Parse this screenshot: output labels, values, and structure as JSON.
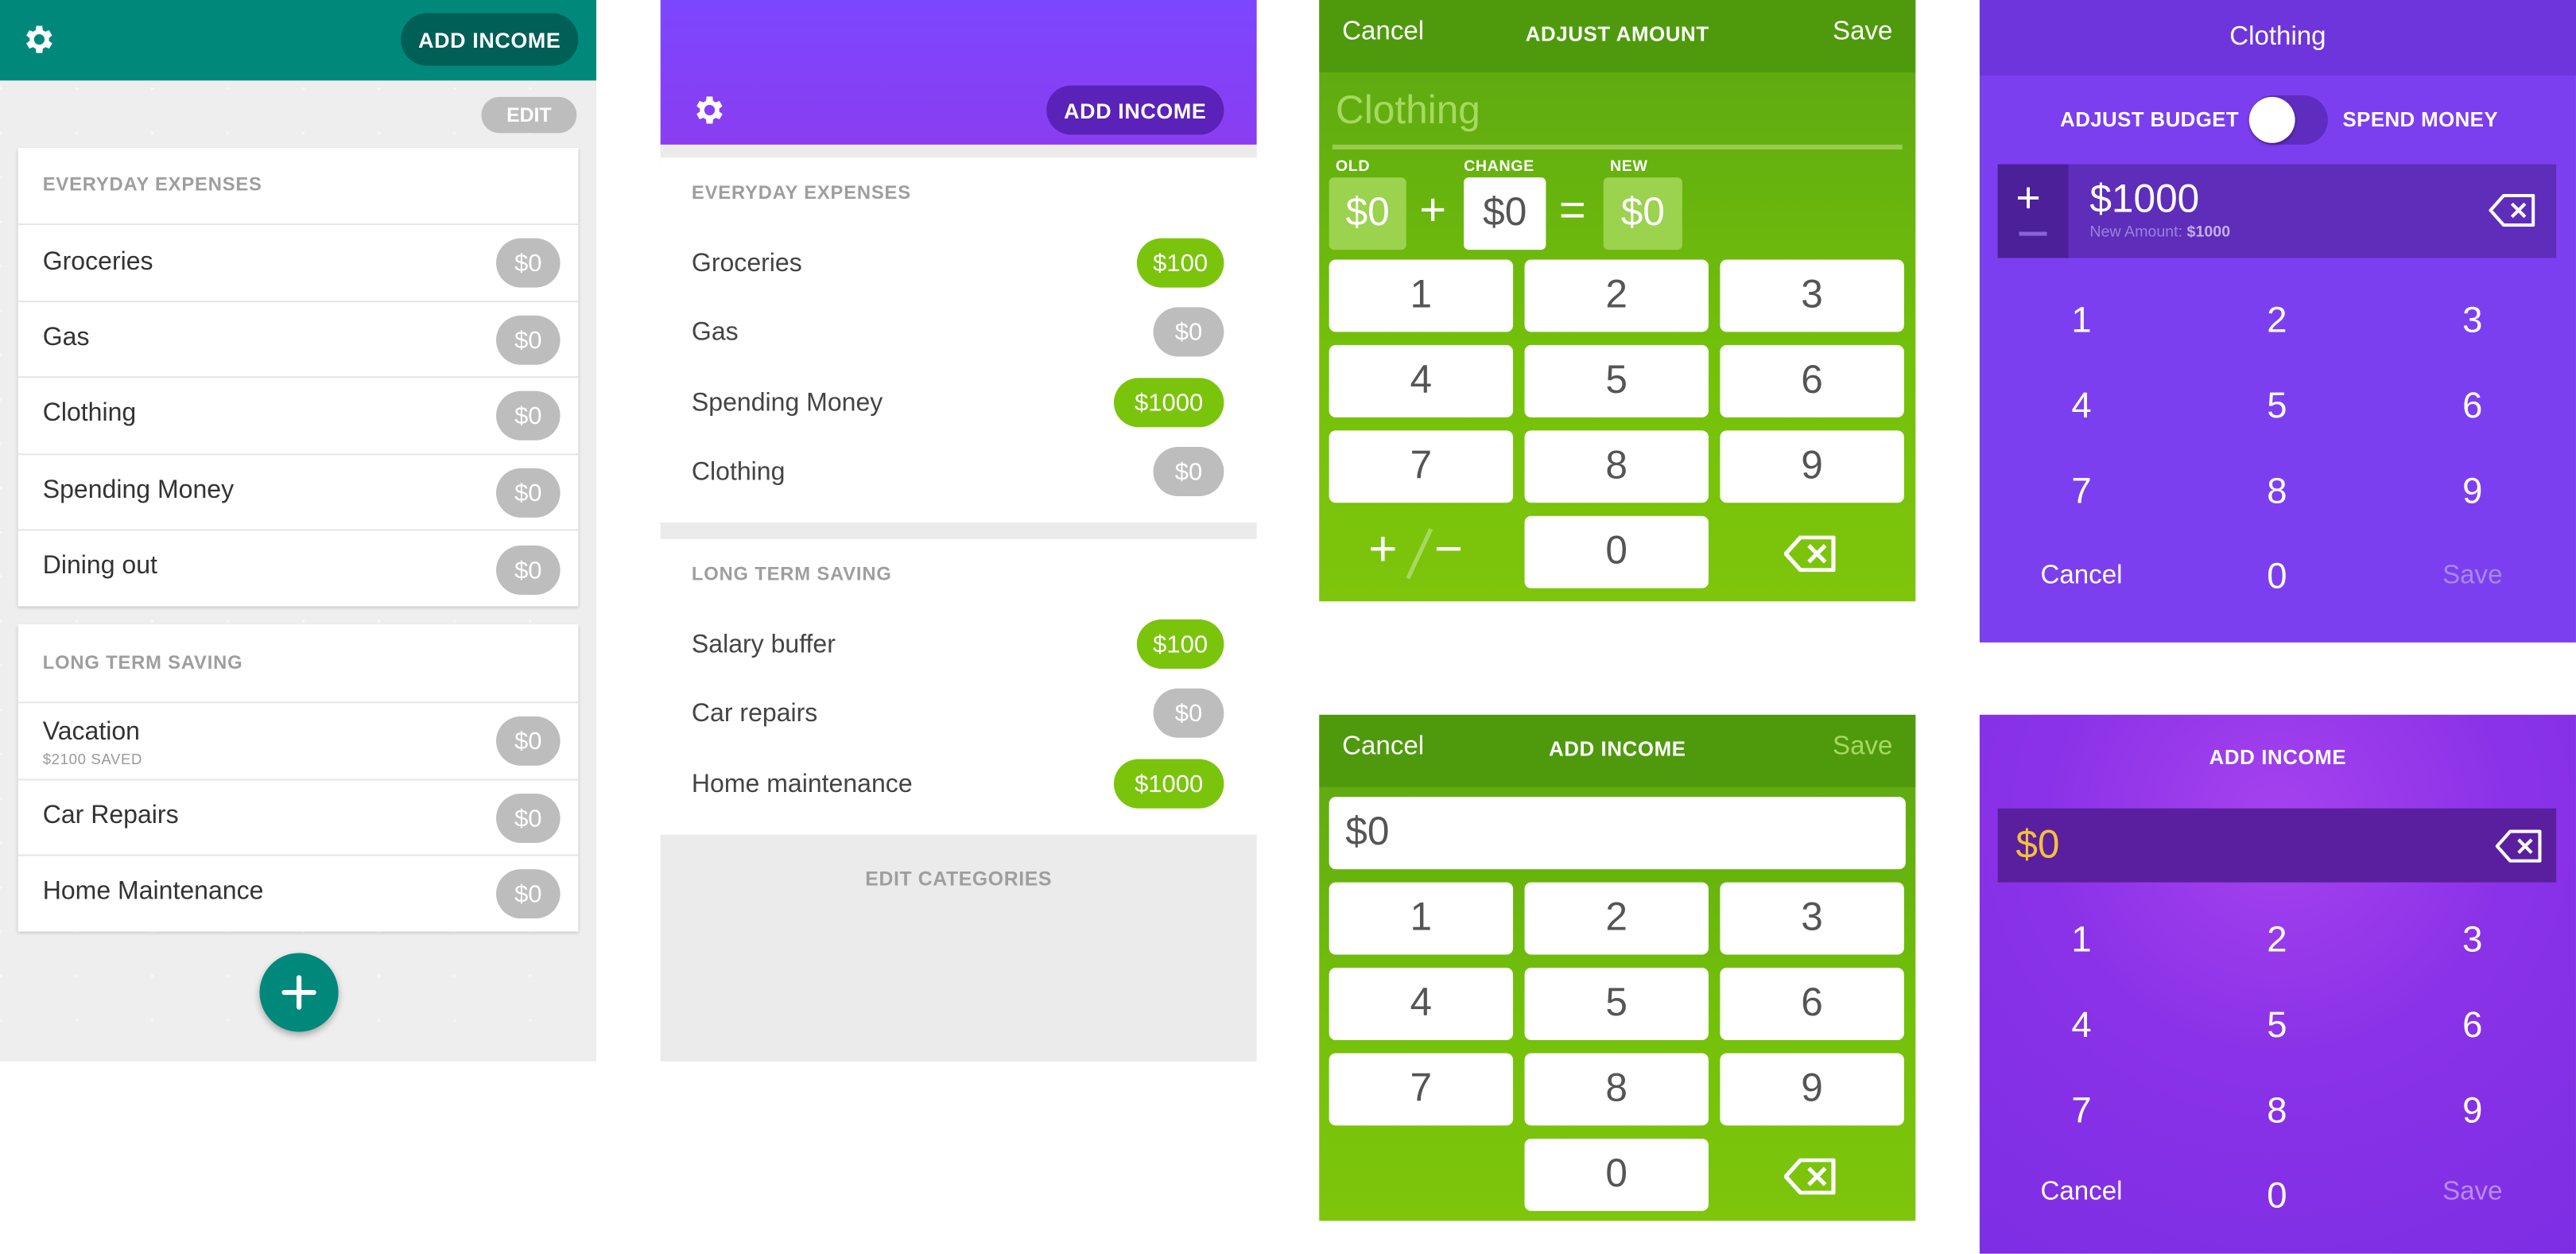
{
  "colors": {
    "teal": "#00897b",
    "teal_dark": "#005f56",
    "purple": "#7c46ff",
    "purple_dark": "#5a22b8",
    "green": "#74c10a",
    "green_dark": "#4e9a0c",
    "badge_gray": "#bdbdbd",
    "badge_green": "#7bc40c",
    "gold": "#f3c13a"
  },
  "teal_list": {
    "add_income": "ADD INCOME",
    "edit": "EDIT",
    "sections": [
      {
        "title": "EVERYDAY EXPENSES",
        "rows": [
          {
            "label": "Groceries",
            "amount": "$0"
          },
          {
            "label": "Gas",
            "amount": "$0"
          },
          {
            "label": "Clothing",
            "amount": "$0"
          },
          {
            "label": "Spending Money",
            "amount": "$0"
          },
          {
            "label": "Dining out",
            "amount": "$0"
          }
        ]
      },
      {
        "title": "LONG TERM SAVING",
        "rows": [
          {
            "label": "Vacation",
            "sub": "$2100 SAVED",
            "amount": "$0"
          },
          {
            "label": "Car Repairs",
            "amount": "$0"
          },
          {
            "label": "Home Maintenance",
            "amount": "$0"
          }
        ]
      }
    ],
    "fab_icon": "plus-icon",
    "settings_icon": "gear-icon"
  },
  "purple_list": {
    "add_income": "ADD INCOME",
    "settings_icon": "gear-icon",
    "sections": [
      {
        "title": "EVERYDAY EXPENSES",
        "rows": [
          {
            "label": "Groceries",
            "amount": "$100",
            "highlight": true
          },
          {
            "label": "Gas",
            "amount": "$0",
            "highlight": false
          },
          {
            "label": "Spending Money",
            "amount": "$1000",
            "highlight": true
          },
          {
            "label": "Clothing",
            "amount": "$0",
            "highlight": false
          }
        ]
      },
      {
        "title": "LONG TERM SAVING",
        "rows": [
          {
            "label": "Salary buffer",
            "amount": "$100",
            "highlight": true
          },
          {
            "label": "Car repairs",
            "amount": "$0",
            "highlight": false
          },
          {
            "label": "Home maintenance",
            "amount": "$1000",
            "highlight": true
          }
        ]
      }
    ],
    "edit_categories": "EDIT CATEGORIES"
  },
  "adjust_amount": {
    "cancel": "Cancel",
    "title": "ADJUST AMOUNT",
    "save": "Save",
    "category": "Clothing",
    "old_label": "OLD",
    "old_value": "$0",
    "plus": "+",
    "change_label": "CHANGE",
    "change_value": "$0",
    "equals": "=",
    "new_label": "NEW",
    "new_value": "$0",
    "keys": [
      "1",
      "2",
      "3",
      "4",
      "5",
      "6",
      "7",
      "8",
      "9",
      "0"
    ],
    "sign_toggle": "+/−",
    "sign_plus": "+",
    "sign_minus": "−"
  },
  "green_add_income": {
    "cancel": "Cancel",
    "title": "ADD INCOME",
    "save": "Save",
    "value": "$0",
    "keys": [
      "1",
      "2",
      "3",
      "4",
      "5",
      "6",
      "7",
      "8",
      "9",
      "0"
    ]
  },
  "purple_adjust": {
    "title": "Clothing",
    "adjust_budget": "ADJUST BUDGET",
    "spend_money": "SPEND MONEY",
    "toggle_on": false,
    "plus": "+",
    "amount": "$1000",
    "new_amount_label": "New Amount:",
    "new_amount_value": "$1000",
    "keys": [
      "1",
      "2",
      "3",
      "4",
      "5",
      "6",
      "7",
      "8",
      "9",
      "0"
    ],
    "cancel": "Cancel",
    "save": "Save"
  },
  "purple_add_income": {
    "title": "ADD INCOME",
    "value": "$0",
    "keys": [
      "1",
      "2",
      "3",
      "4",
      "5",
      "6",
      "7",
      "8",
      "9",
      "0"
    ],
    "cancel": "Cancel",
    "save": "Save"
  }
}
